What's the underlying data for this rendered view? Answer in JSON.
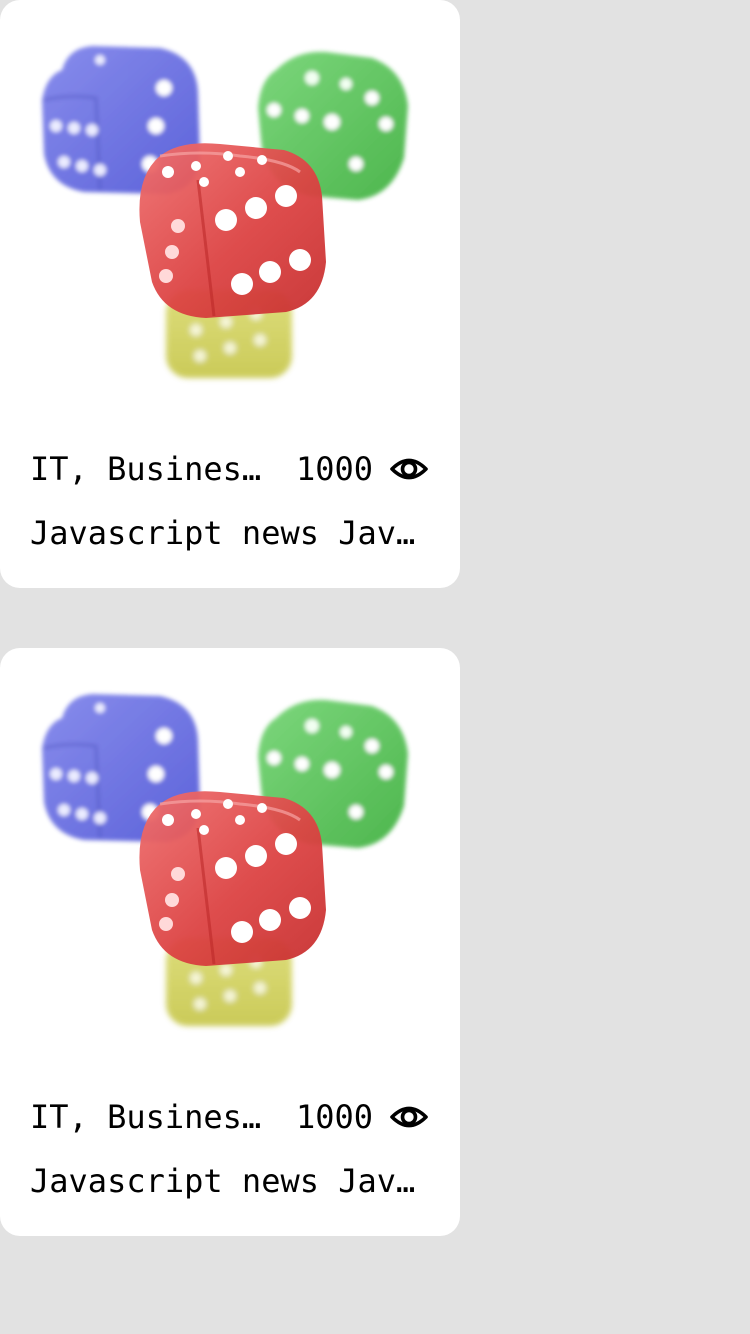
{
  "feed": {
    "cards": [
      {
        "image_alt": "Colored dice",
        "tags": "IT, Business, Javascript",
        "views": "1000",
        "view_icon": "eye-icon",
        "title": "Javascript news Javascript news"
      },
      {
        "image_alt": "Colored dice",
        "tags": "IT, Business, Javascript",
        "views": "1000",
        "view_icon": "eye-icon",
        "title": "Javascript news Javascript news"
      }
    ]
  },
  "colors": {
    "page_background": "#e2e2e2",
    "card_background": "#ffffff",
    "text": "#000000",
    "die_blue": "#5f67e0",
    "die_green": "#48bf48",
    "die_red": "#e24a4a",
    "die_yellow": "#cfcf4a"
  }
}
